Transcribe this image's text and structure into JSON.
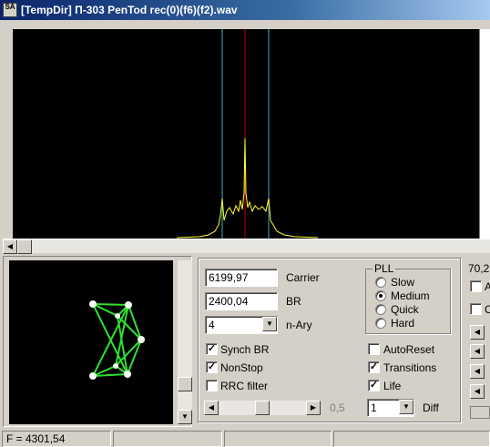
{
  "window": {
    "title": "[TempDir] П-303 PenTod rec(0)(f6)(f2).wav",
    "icon_text": "SA"
  },
  "controls": {
    "carrier_value": "6199,97",
    "carrier_label": "Carrier",
    "br_value": "2400,04",
    "br_label": "BR",
    "nary_value": "4",
    "nary_label": "n-Ary",
    "synch_br_label": "Synch BR",
    "synch_br_checked": true,
    "nonstop_label": "NonStop",
    "nonstop_checked": true,
    "rrc_label": "RRC filter",
    "rrc_checked": false,
    "slider_value": "0,5",
    "slider_level": 0.5
  },
  "pll": {
    "title": "PLL",
    "options": [
      "Slow",
      "Medium",
      "Quick",
      "Hard"
    ],
    "selected": "Medium"
  },
  "right_options": {
    "autoreset_label": "AutoReset",
    "autoreset_checked": false,
    "transitions_label": "Transitions",
    "transitions_checked": true,
    "life_label": "Life",
    "life_checked": true,
    "diff_value": "1",
    "diff_label": "Diff"
  },
  "side_panel": {
    "value_text": "70,2",
    "letter_a": "A",
    "letter_c": "C"
  },
  "status": {
    "frequency": "F = 4301,54"
  },
  "colors": {
    "marker_red": "#c00000",
    "marker_cyan": "#3ab0c0",
    "spectrum": "#ffff30",
    "constellation": "#30e030"
  }
}
